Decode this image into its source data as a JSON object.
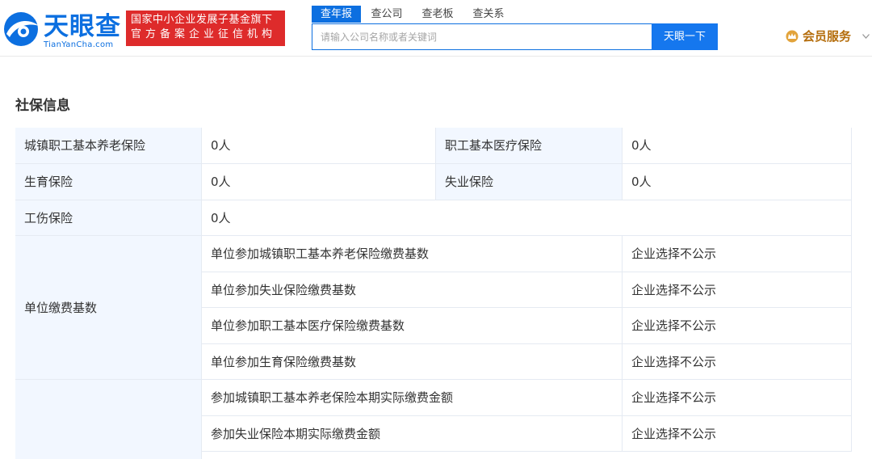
{
  "header": {
    "logo": {
      "name": "天眼查",
      "domain": "TianYanCha.com"
    },
    "badge": {
      "line1": "国家中小企业发展子基金旗下",
      "line2": "官方备案企业征信机构"
    },
    "tabs": [
      {
        "label": "查年报",
        "active": true
      },
      {
        "label": "查公司",
        "active": false
      },
      {
        "label": "查老板",
        "active": false
      },
      {
        "label": "查关系",
        "active": false
      }
    ],
    "search": {
      "placeholder": "请输入公司名称或者关键词",
      "value": "",
      "button_label": "天眼一下"
    },
    "member": {
      "label": "会员服务",
      "icon": "crown-icon"
    }
  },
  "section": {
    "title": "社保信息"
  },
  "insurance": {
    "pension": {
      "label": "城镇职工基本养老保险",
      "value": "0人"
    },
    "medical": {
      "label": "职工基本医疗保险",
      "value": "0人"
    },
    "maternity": {
      "label": "生育保险",
      "value": "0人"
    },
    "unemployment": {
      "label": "失业保险",
      "value": "0人"
    },
    "injury": {
      "label": "工伤保险",
      "value": "0人"
    }
  },
  "contribution_base": {
    "label": "单位缴费基数",
    "rows": [
      {
        "item": "单位参加城镇职工基本养老保险缴费基数",
        "value": "企业选择不公示"
      },
      {
        "item": "单位参加失业保险缴费基数",
        "value": "企业选择不公示"
      },
      {
        "item": "单位参加职工基本医疗保险缴费基数",
        "value": "企业选择不公示"
      },
      {
        "item": "单位参加生育保险缴费基数",
        "value": "企业选择不公示"
      }
    ]
  },
  "actual_payment": {
    "rows": [
      {
        "item": "参加城镇职工基本养老保险本期实际缴费金额",
        "value": "企业选择不公示"
      },
      {
        "item": "参加失业保险本期实际缴费金额",
        "value": "企业选择不公示"
      }
    ]
  },
  "colors": {
    "brand_blue": "#0c6fe0",
    "badge_red": "#de2b2b",
    "member_gold": "#b46d0c",
    "label_bg": "#f2f7ff",
    "border": "#e5eaf2"
  }
}
